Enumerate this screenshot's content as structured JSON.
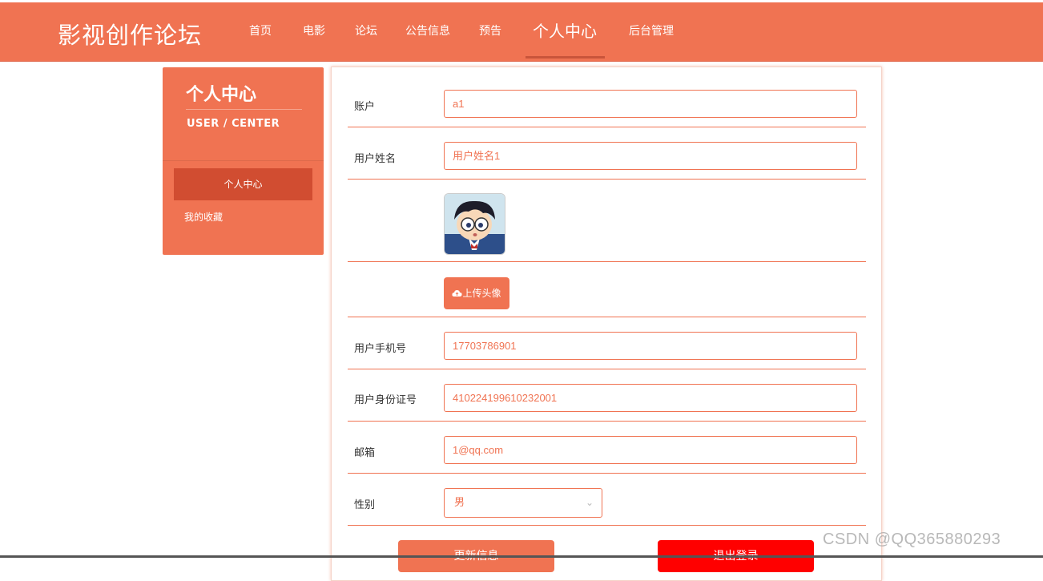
{
  "site": {
    "title": "影视创作论坛"
  },
  "nav": {
    "items": [
      {
        "label": "首页"
      },
      {
        "label": "电影"
      },
      {
        "label": "论坛"
      },
      {
        "label": "公告信息"
      },
      {
        "label": "预告"
      },
      {
        "label": "个人中心",
        "active": true
      },
      {
        "label": "后台管理"
      }
    ]
  },
  "sidebar": {
    "title": "个人中心",
    "subtitle": "USER / CENTER",
    "items": [
      {
        "label": "个人中心",
        "active": true
      },
      {
        "label": "我的收藏"
      }
    ]
  },
  "form": {
    "account": {
      "label": "账户",
      "value": "a1"
    },
    "username": {
      "label": "用户姓名",
      "value": "用户姓名1"
    },
    "avatar": {
      "icon": "avatar-image"
    },
    "upload": {
      "label": "上传头像",
      "icon": "cloud-upload-icon"
    },
    "phone": {
      "label": "用户手机号",
      "value": "17703786901"
    },
    "idcard": {
      "label": "用户身份证号",
      "value": "410224199610232001"
    },
    "email": {
      "label": "邮箱",
      "value": "1@qq.com"
    },
    "gender": {
      "label": "性别",
      "value": "男",
      "icon": "chevron-down-icon"
    },
    "update_label": "更新信息",
    "logout_label": "退出登录"
  },
  "watermark": "CSDN @QQ365880293",
  "colors": {
    "accent": "#f07352",
    "danger": "#ff0000",
    "active_menu": "#d14d31"
  }
}
